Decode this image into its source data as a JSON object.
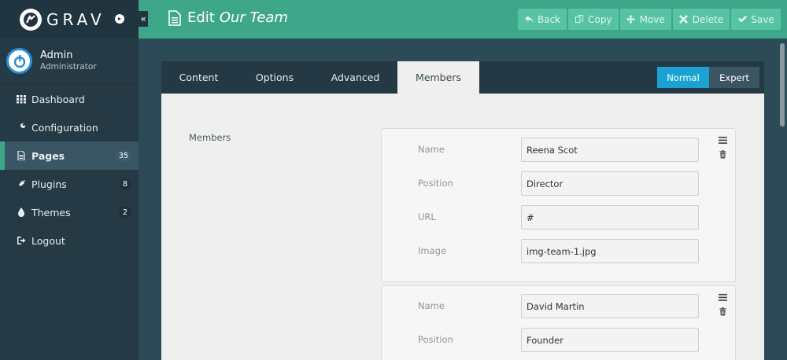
{
  "brand": {
    "name": "GRAV"
  },
  "user": {
    "name": "Admin",
    "role": "Administrator"
  },
  "sidebar": {
    "items": [
      {
        "label": "Dashboard",
        "icon": "dashboard-icon"
      },
      {
        "label": "Configuration",
        "icon": "wrench-icon"
      },
      {
        "label": "Pages",
        "icon": "file-icon",
        "badge": "35",
        "active": true
      },
      {
        "label": "Plugins",
        "icon": "plug-icon",
        "badge": "8"
      },
      {
        "label": "Themes",
        "icon": "tint-icon",
        "badge": "2"
      },
      {
        "label": "Logout",
        "icon": "sign-out-icon"
      }
    ]
  },
  "header": {
    "title_prefix": "Edit",
    "title_page": "Our Team",
    "actions": [
      {
        "label": "Back",
        "icon": "reply-icon"
      },
      {
        "label": "Copy",
        "icon": "copy-icon"
      },
      {
        "label": "Move",
        "icon": "arrows-icon"
      },
      {
        "label": "Delete",
        "icon": "close-icon"
      },
      {
        "label": "Save",
        "icon": "check-icon"
      }
    ]
  },
  "tabs": [
    {
      "label": "Content"
    },
    {
      "label": "Options"
    },
    {
      "label": "Advanced"
    },
    {
      "label": "Members",
      "active": true
    }
  ],
  "mode": {
    "normal": "Normal",
    "expert": "Expert"
  },
  "form": {
    "members_label": "Members",
    "labels": {
      "name": "Name",
      "position": "Position",
      "url": "URL",
      "image": "Image"
    },
    "members": [
      {
        "name": "Reena Scot",
        "position": "Director",
        "url": "#",
        "image": "img-team-1.jpg"
      },
      {
        "name": "David Martin",
        "position": "Founder"
      }
    ]
  },
  "colors": {
    "header": "#3ea78a",
    "sidebar": "#253a45",
    "accent_blue": "#1aa3d2",
    "button": "#56c4a4"
  }
}
